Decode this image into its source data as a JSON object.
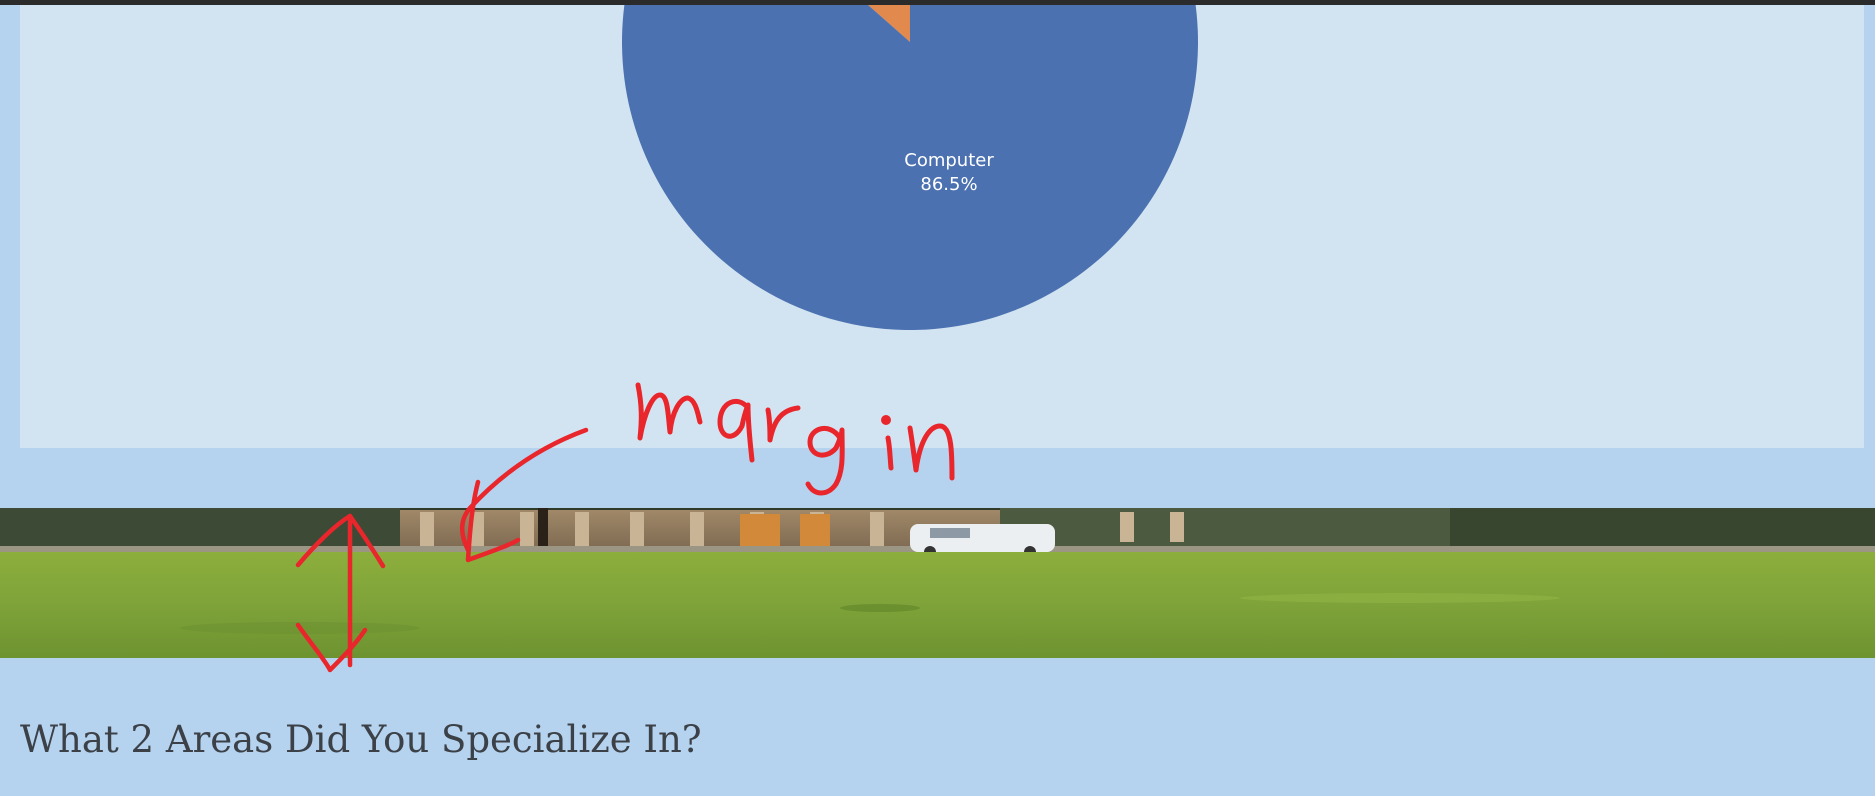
{
  "chart_data": {
    "type": "pie",
    "slices": [
      {
        "label": "Computer",
        "percent": 86.5,
        "color": "#4b71b0"
      },
      {
        "label": "",
        "percent": 13.5,
        "color": "#e2894e"
      }
    ],
    "visible_labels": [
      {
        "name": "Computer",
        "value": "86.5%"
      }
    ]
  },
  "hero": {
    "image": "campus-lawn-photo"
  },
  "annotation": {
    "text": "margin",
    "color": "#e8262b"
  },
  "section": {
    "heading": "What 2 Areas Did You Specialize In?"
  },
  "colors": {
    "page_bg": "#b5d3ef",
    "panel_bg": "#d2e4f1",
    "top_bar": "#2b2b2b",
    "heading_text": "#3c4148"
  }
}
